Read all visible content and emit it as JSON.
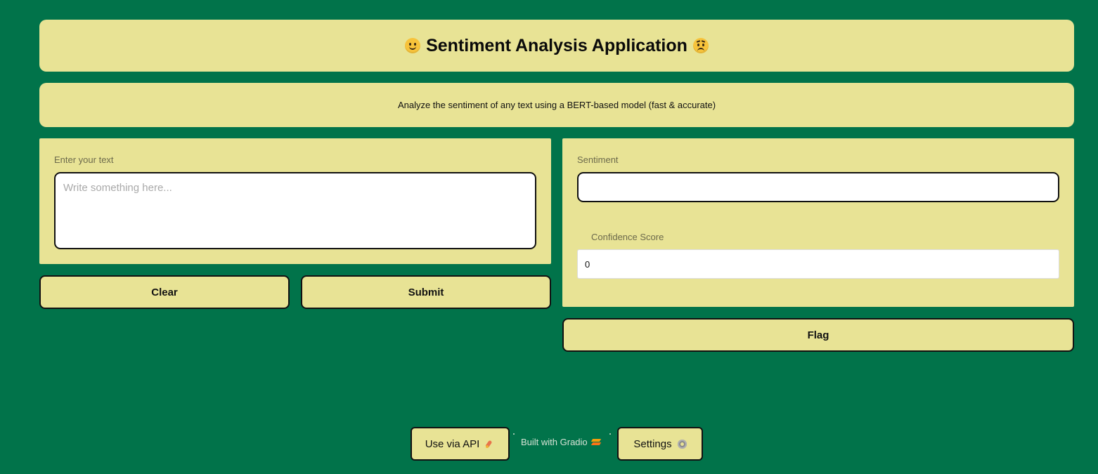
{
  "header": {
    "title": "Sentiment Analysis Application"
  },
  "description": "Analyze the sentiment of any text using a BERT-based model (fast & accurate)",
  "input": {
    "label": "Enter your text",
    "placeholder": "Write something here...",
    "value": ""
  },
  "output": {
    "sentiment_label": "Sentiment",
    "sentiment_value": "",
    "confidence_label": "Confidence Score",
    "confidence_value": "0"
  },
  "buttons": {
    "clear": "Clear",
    "submit": "Submit",
    "flag": "Flag"
  },
  "footer": {
    "api_label": "Use via API",
    "built_with": "Built with Gradio",
    "settings_label": "Settings"
  },
  "colors": {
    "background": "#01734a",
    "panel": "#e8e395",
    "border": "#111111"
  },
  "icons": {
    "title_left": "smiling-face-icon",
    "title_right": "frowning-face-icon",
    "api": "rocket-icon",
    "gradio": "gradio-logo-icon",
    "settings": "gear-icon"
  }
}
